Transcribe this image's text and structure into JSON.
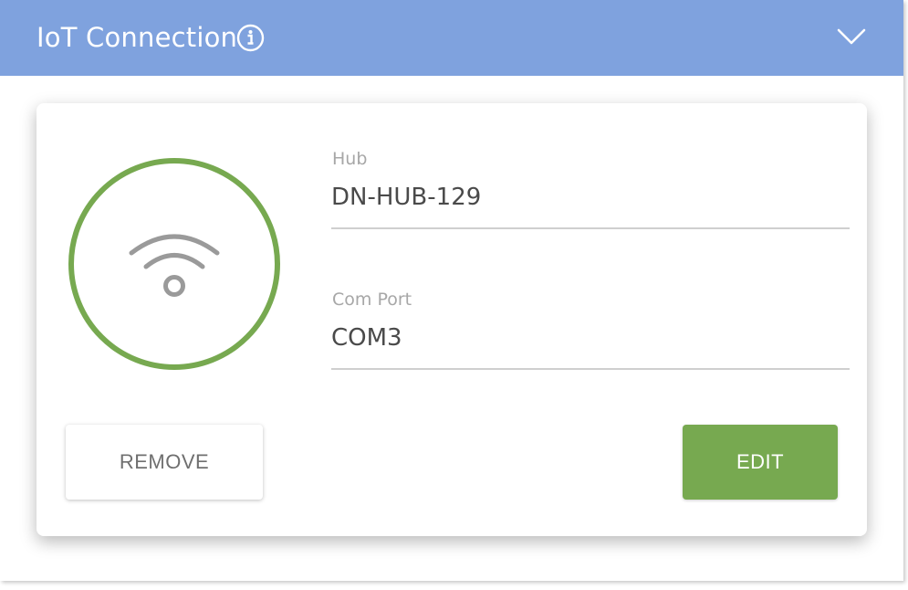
{
  "header": {
    "title": "IoT Connection",
    "info_icon": "info-circle-icon",
    "collapse_icon": "chevron-down-icon",
    "background_color": "#7fa2de"
  },
  "connection": {
    "status_icon": "wifi-icon",
    "ring_color": "#77a950",
    "hub_label": "Hub",
    "hub_value": "DN-HUB-129",
    "com_port_label": "Com Port",
    "com_port_value": "COM3"
  },
  "actions": {
    "remove_label": "REMOVE",
    "edit_label": "EDIT",
    "edit_color": "#77a950"
  }
}
